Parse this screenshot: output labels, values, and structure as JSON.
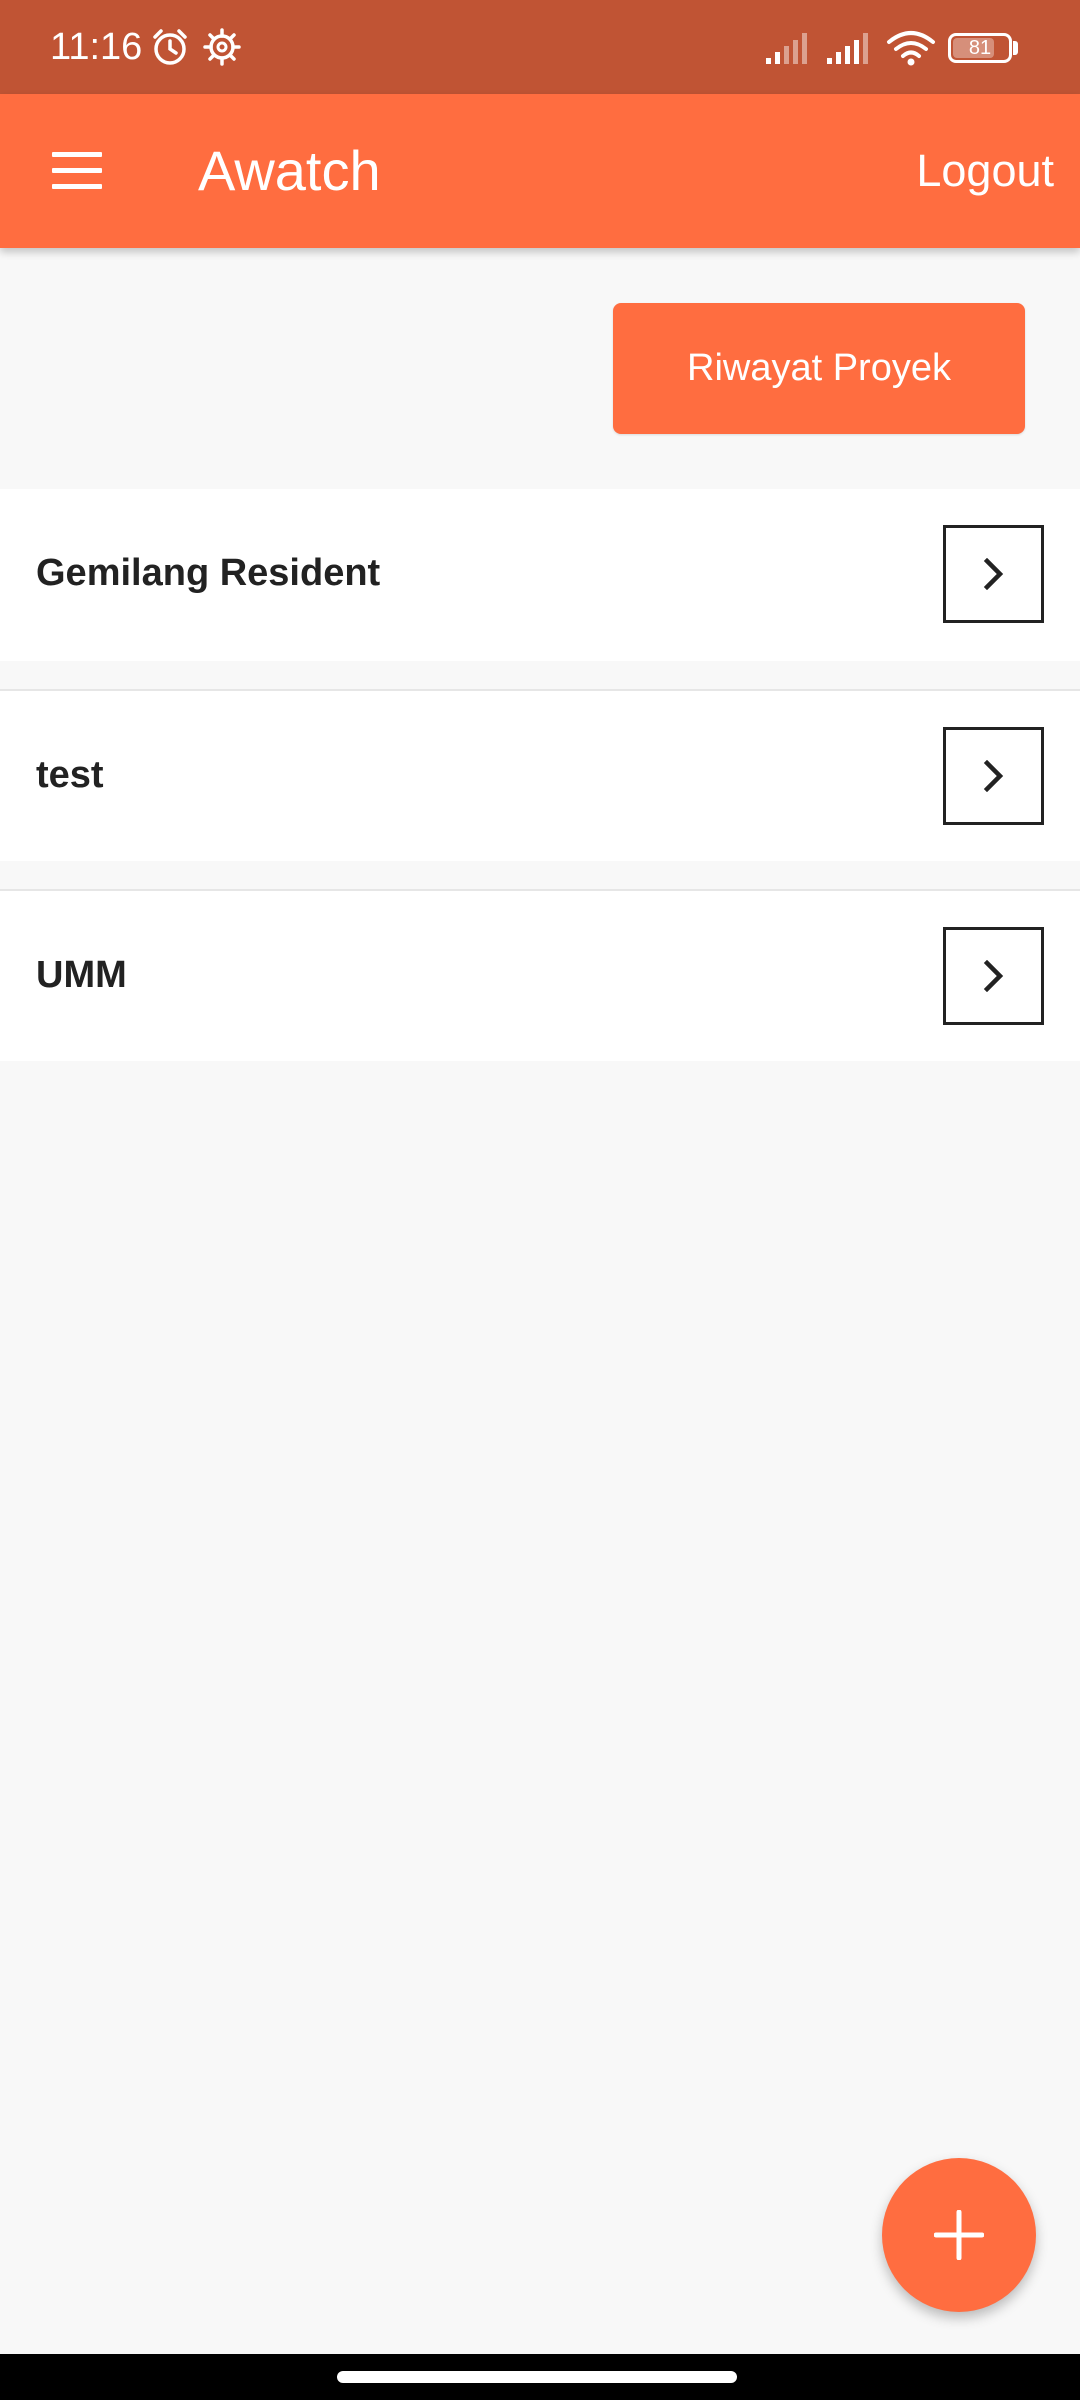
{
  "status_bar": {
    "time": "11:16",
    "battery_level": "81",
    "icons": [
      "alarm-icon",
      "settings-gear-icon",
      "signal-icon",
      "signal-icon",
      "wifi-icon",
      "battery-icon"
    ]
  },
  "app_bar": {
    "title": "Awatch",
    "logout_label": "Logout",
    "menu_icon": "hamburger-menu-icon"
  },
  "history_button": {
    "label": "Riwayat Proyek"
  },
  "projects": [
    {
      "name": "Gemilang Resident"
    },
    {
      "name": "test"
    },
    {
      "name": "UMM"
    }
  ],
  "fab": {
    "icon": "plus-icon"
  },
  "colors": {
    "status_bar": "#c05434",
    "primary": "#ff6d40",
    "background": "#f8f8f8",
    "text": "#222222"
  }
}
